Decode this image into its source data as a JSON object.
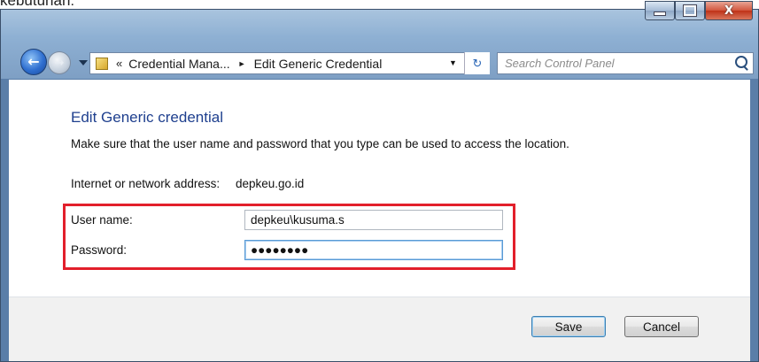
{
  "top_caption": "kebutuhan:",
  "window": {
    "caption_buttons": {
      "minimize_icon": "minimize-icon",
      "maximize_icon": "maximize-icon",
      "close_glyph": "X"
    },
    "nav": {
      "back_glyph": "←",
      "forward_glyph": "→",
      "address": {
        "overflow_glyph": "«",
        "crumbs": [
          "Credential Mana...",
          "Edit Generic Credential"
        ],
        "separator_glyph": "►",
        "dropdown_glyph": "▼"
      },
      "refresh_glyph": "↻",
      "search_placeholder": "Search Control Panel"
    }
  },
  "content": {
    "heading": "Edit Generic credential",
    "description": "Make sure that the user name and password that you type can be used to access the location.",
    "address_label": "Internet or network address:",
    "address_value": "depkeu.go.id",
    "username_label": "User name:",
    "username_value": "depkeu\\kusuma.s",
    "password_label": "Password:",
    "password_value": "●●●●●●●●"
  },
  "buttons": {
    "save": "Save",
    "cancel": "Cancel"
  },
  "colors": {
    "highlight_border": "#e21f2b",
    "heading_blue": "#1e3f8e"
  }
}
